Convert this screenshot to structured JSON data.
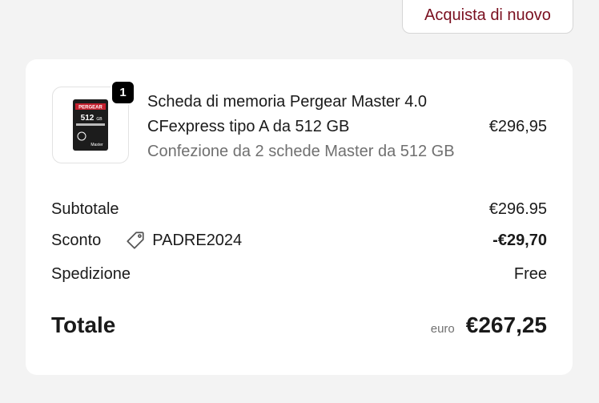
{
  "header": {
    "buy_again_label": "Acquista di nuovo"
  },
  "item": {
    "quantity": "1",
    "title": "Scheda di memoria Pergear Master 4.0 CFexpress tipo A da 512 GB",
    "variant": "Confezione da 2 schede Master da 512 GB",
    "price": "€296,95",
    "image_text": {
      "brand": "PERGEAR",
      "capacity": "512",
      "unit": "GB",
      "series": "Master"
    }
  },
  "summary": {
    "subtotal_label": "Subtotale",
    "subtotal_value": "€296.95",
    "discount_label": "Sconto",
    "discount_code": "PADRE2024",
    "discount_value": "-€29,70",
    "shipping_label": "Spedizione",
    "shipping_value": "Free",
    "total_label": "Totale",
    "total_currency": "euro",
    "total_value": "€267,25"
  },
  "colors": {
    "accent": "#7a1020",
    "background": "#f3f3f3",
    "card": "#ffffff",
    "muted_text": "#707070"
  },
  "icons": {
    "discount": "tag-icon"
  }
}
